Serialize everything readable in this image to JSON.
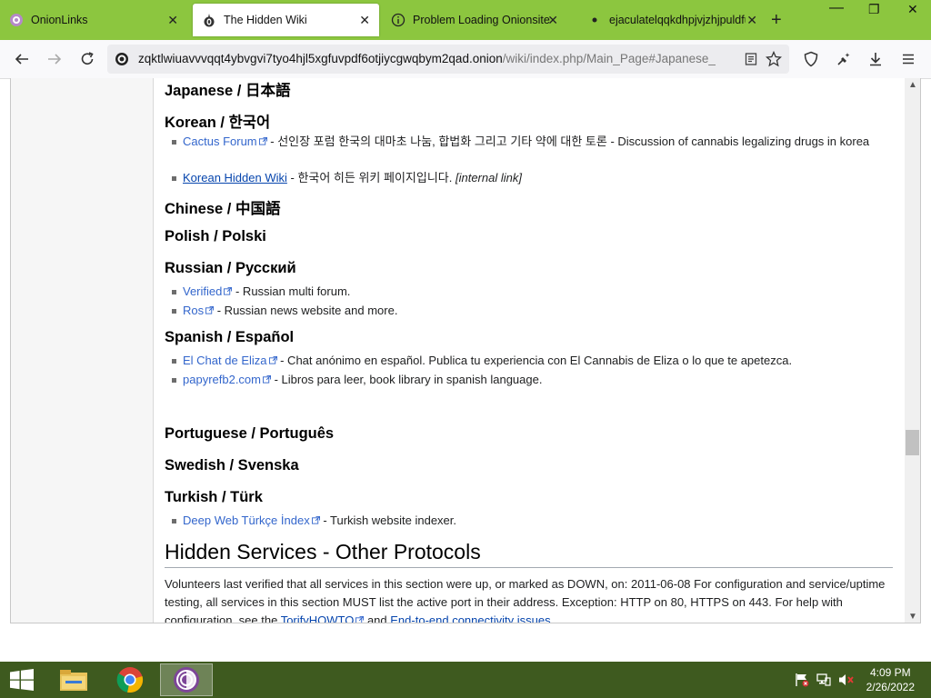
{
  "browser": {
    "tabs": [
      {
        "title": "OnionLinks",
        "close": "✕"
      },
      {
        "title": "The Hidden Wiki",
        "close": "✕"
      },
      {
        "title": "Problem Loading Onionsite",
        "close": "✕"
      },
      {
        "title": "ejaculatelqqkdhpjvjzhjpuldfu",
        "close": "✕"
      }
    ],
    "new_tab": "+",
    "window_controls": {
      "minimize": "—",
      "restore": "❐",
      "close": "✕"
    },
    "url": {
      "host": "zqktlwiuavvvqqt4ybvgvi7tyo4hjl5xgfuvpdf6otjiycgwqbym2qad.onion",
      "path": "/wiki/index.php/Main_Page#Japanese_"
    },
    "colors": {
      "tabstrip": "#8cc63f",
      "taskbar": "#3e5a1f"
    }
  },
  "article": {
    "japanese_heading": "Japanese / 日本語",
    "korean_heading": "Korean / 한국어",
    "korean_items": [
      {
        "link": "Cactus Forum",
        "desc": " - 선인장 포럼 한국의 대마초 나눔, 합법화 그리고 기타 약에 대한 토론 - Discussion of cannabis legalizing drugs in korea"
      },
      {
        "link": "Korean Hidden Wiki",
        "desc": " - 한국어 히든 위키 페이지입니다. ",
        "note": "[internal link]"
      }
    ],
    "chinese_heading": "Chinese / 中国語",
    "polish_heading": "Polish / Polski",
    "russian_heading": "Russian / Русский",
    "russian_items": [
      {
        "link": "Verified",
        "desc": " - Russian multi forum."
      },
      {
        "link": "Ros",
        "desc": " - Russian news website and more."
      }
    ],
    "spanish_heading": "Spanish / Español",
    "spanish_items": [
      {
        "link": "El Chat de Eliza",
        "desc": " - Chat anónimo en español. Publica tu experiencia con El Cannabis de Eliza o lo que te apetezca."
      },
      {
        "link": "papyrefb2.com",
        "desc": " - Libros para leer, book library in spanish language."
      }
    ],
    "portuguese_heading": "Portuguese / Português",
    "swedish_heading": "Swedish / Svenska",
    "turkish_heading": "Turkish / Türk",
    "turkish_items": [
      {
        "link": "Deep Web Türkçe İndex",
        "desc": " - Turkish website indexer."
      }
    ],
    "section_title": "Hidden Services - Other Protocols",
    "section_para": {
      "text1": "Volunteers last verified that all services in this section were up, or marked as DOWN, on: 2011-06-08 For configuration and service/uptime testing, all services in this section MUST list the active port in their address. Exception: HTTP on 80, HTTPS on 443. For help with configuration, see the ",
      "link1": "TorifyHOWTO",
      "text2": " and ",
      "link2": "End-to-end connectivity issues",
      "text3": "."
    }
  },
  "taskbar": {
    "time": "4:09 PM",
    "date": "2/26/2022"
  }
}
